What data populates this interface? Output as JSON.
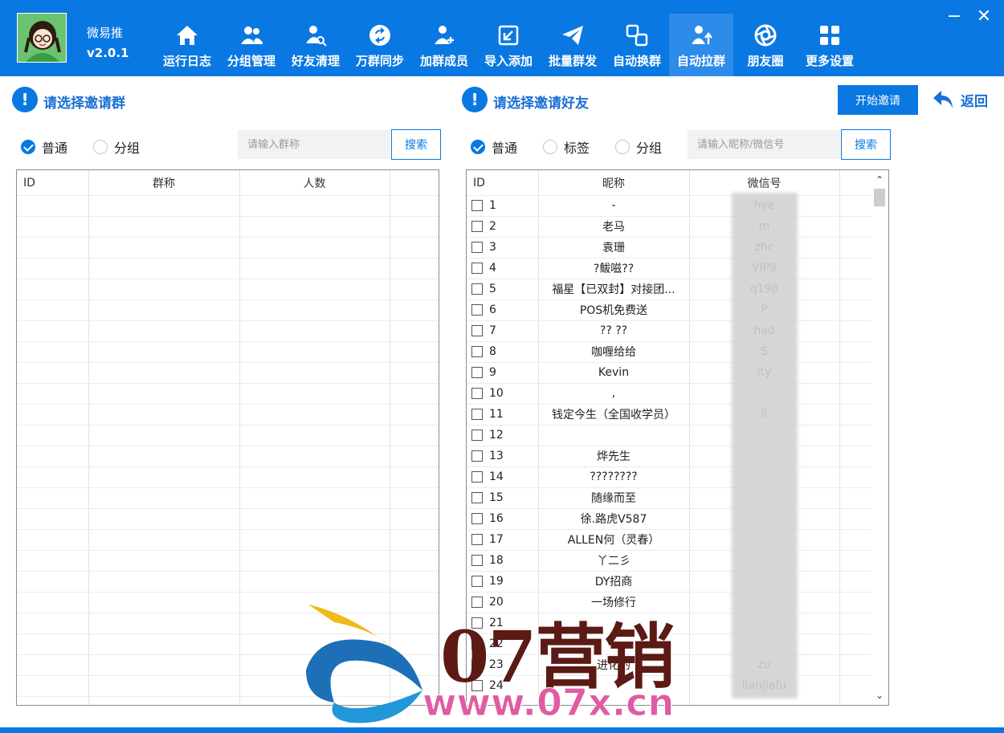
{
  "app": {
    "name": "微易推",
    "version": "v2.0.1"
  },
  "nav": [
    {
      "label": "运行日志",
      "icon": "home-icon"
    },
    {
      "label": "分组管理",
      "icon": "users-icon"
    },
    {
      "label": "好友清理",
      "icon": "user-search-icon"
    },
    {
      "label": "万群同步",
      "icon": "sync-icon"
    },
    {
      "label": "加群成员",
      "icon": "user-add-icon"
    },
    {
      "label": "导入添加",
      "icon": "import-icon"
    },
    {
      "label": "批量群发",
      "icon": "send-icon"
    },
    {
      "label": "自动换群",
      "icon": "swap-icon"
    },
    {
      "label": "自动拉群",
      "icon": "pull-group-icon"
    },
    {
      "label": "朋友圈",
      "icon": "aperture-icon"
    },
    {
      "label": "更多设置",
      "icon": "grid-icon"
    }
  ],
  "window": {
    "minimize": "−",
    "close": "✕"
  },
  "left": {
    "title": "请选择邀请群",
    "radio_normal": "普通",
    "radio_group": "分组",
    "search_placeholder": "请输入群称",
    "search_button": "搜索",
    "columns": [
      "ID",
      "群称",
      "人数"
    ]
  },
  "right": {
    "title": "请选择邀请好友",
    "start_button": "开始邀请",
    "back": "返回",
    "radio_normal": "普通",
    "radio_tag": "标签",
    "radio_group": "分组",
    "search_placeholder": "请输入昵称/微信号",
    "search_button": "搜索",
    "columns": [
      "ID",
      "昵称",
      "微信号"
    ],
    "rows": [
      {
        "id": "1",
        "nick": "-",
        "wx": "hye"
      },
      {
        "id": "2",
        "nick": "老马",
        "wx": "m"
      },
      {
        "id": "3",
        "nick": "袁珊",
        "wx": "zhc"
      },
      {
        "id": "4",
        "nick": "?鲅嗞??",
        "wx": "VIP9"
      },
      {
        "id": "5",
        "nick": "福星【已双封】对接团...",
        "wx": "q198"
      },
      {
        "id": "6",
        "nick": "POS机免费送",
        "wx": "P"
      },
      {
        "id": "7",
        "nick": "?? ??",
        "wx": "had"
      },
      {
        "id": "8",
        "nick": "咖喱给给",
        "wx": "S"
      },
      {
        "id": "9",
        "nick": "Kevin",
        "wx": "lty"
      },
      {
        "id": "10",
        "nick": ",",
        "wx": ""
      },
      {
        "id": "11",
        "nick": "钱定今生（全国收学员）",
        "wx": "ll"
      },
      {
        "id": "12",
        "nick": "",
        "wx": ""
      },
      {
        "id": "13",
        "nick": "烨先生",
        "wx": ""
      },
      {
        "id": "14",
        "nick": "????????",
        "wx": ""
      },
      {
        "id": "15",
        "nick": "随缘而至",
        "wx": ""
      },
      {
        "id": "16",
        "nick": "徐.路虎V587",
        "wx": ""
      },
      {
        "id": "17",
        "nick": "ALLEN何（灵春）",
        "wx": ""
      },
      {
        "id": "18",
        "nick": "丫二彡",
        "wx": ""
      },
      {
        "id": "19",
        "nick": "DY招商",
        "wx": ""
      },
      {
        "id": "20",
        "nick": "一场修行",
        "wx": ""
      },
      {
        "id": "21",
        "nick": "",
        "wx": ""
      },
      {
        "id": "22",
        "nick": "",
        "wx": ""
      },
      {
        "id": "23",
        "nick": "进化的",
        "wx": "zu"
      },
      {
        "id": "24",
        "nick": "",
        "wx": "lianjiafu"
      }
    ]
  },
  "watermark": {
    "text": "07营销",
    "url": "www.07x.cn"
  }
}
